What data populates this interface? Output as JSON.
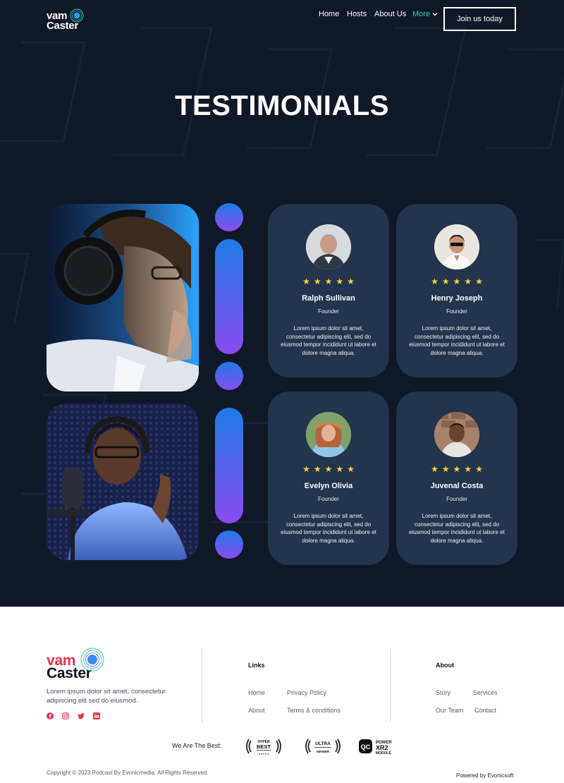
{
  "header": {
    "logo_top": "vam",
    "logo_bottom": "Caster",
    "nav": [
      "Home",
      "Hosts",
      "About Us",
      "More"
    ],
    "cta": "Join us today"
  },
  "hero": {
    "title": "TESTIMONIALS"
  },
  "testimonials": [
    {
      "name": "Ralph Sullivan",
      "role": "Founder",
      "rating": 5,
      "text": "Lorem ipsum dolor sit amet, consectetur adipiscing elit, sed do eiusmod tempor incididunt ut labore et dolore magna aliqua."
    },
    {
      "name": "Henry Joseph",
      "role": "Founder",
      "rating": 5,
      "text": "Lorem ipsum dolor sit amet, consectetur adipiscing elit, sed do eiusmod tempor incididunt ut labore et dolore magna aliqua."
    },
    {
      "name": "Evelyn Olivia",
      "role": "Founder",
      "rating": 5,
      "text": "Lorem ipsum dolor sit amet, consectetur adipiscing elit, sed do eiusmod tempor incididunt ut labore et dolore magna aliqua."
    },
    {
      "name": "Juvenal Costa",
      "role": "Founder",
      "rating": 5,
      "text": "Lorem ipsum dolor sit amet, consectetur adipiscing elit, sed do eiusmod tempor incididunt ut labore et dolore magna aliqua."
    }
  ],
  "footer": {
    "logo_top": "vam",
    "logo_bottom": "Caster",
    "description": "Lorem ipsum dolor sit amet, consectetur adipiscing elit  sed do eiusmod.",
    "socials": [
      "facebook-icon",
      "instagram-icon",
      "twitter-icon",
      "linkedin-icon"
    ],
    "links_title": "Links",
    "links": [
      "Home",
      "Privacy Policy",
      "About",
      "Terms & conditions"
    ],
    "about_title": "About",
    "about_links": [
      "Story",
      "Services",
      "Our Team",
      "Contact"
    ],
    "best_label": "We Are The Best:",
    "badges": [
      {
        "line1": "HYPER",
        "line2": "BEST"
      },
      {
        "line1": "ULTRA",
        "line2": "WINNER"
      },
      {
        "line1": "POWER",
        "line2": "XR2",
        "line3": "MODULE"
      }
    ],
    "copyright": "Copyright © 2023 Podcast By Evonicmedia. All Rights Reserved.",
    "powered": "Powered by Evonicsoft"
  },
  "colors": {
    "background_dark": "#0f1826",
    "card": "#23344d",
    "accent_teal": "#2ed2b7",
    "star": "#ffd23f",
    "gradient_top": "#1f7ae6",
    "gradient_bottom": "#8a4bf0",
    "logo_red": "#e8334a"
  }
}
